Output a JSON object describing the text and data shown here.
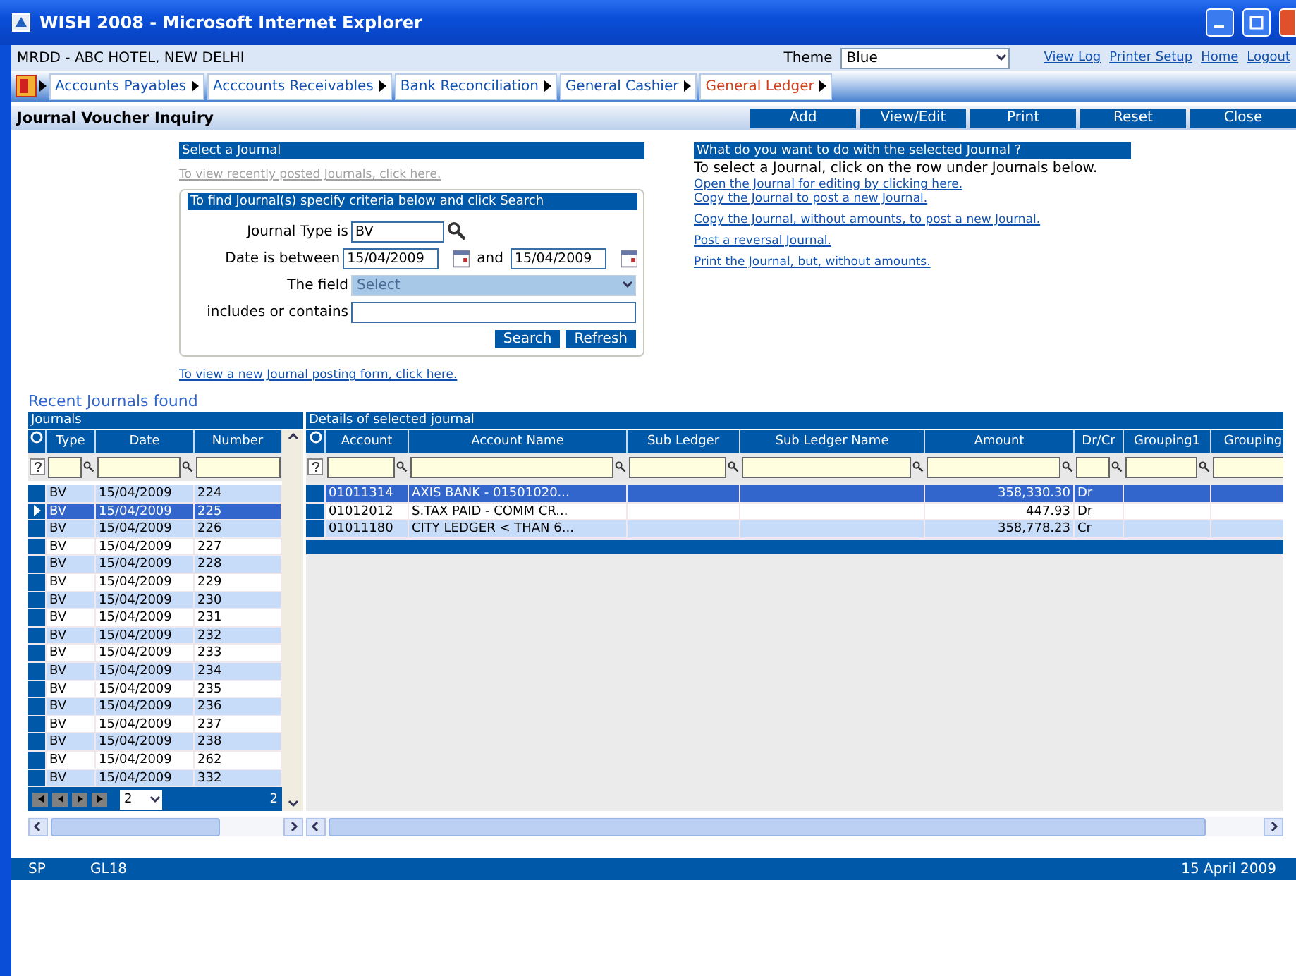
{
  "window": {
    "title": "WISH 2008 - Microsoft Internet Explorer"
  },
  "header": {
    "property": "MRDD - ABC HOTEL, NEW DELHI",
    "theme_label": "Theme",
    "theme_value": "Blue",
    "links": [
      "View Log",
      "Printer Setup",
      "Home",
      "Logout"
    ]
  },
  "modules": [
    {
      "label": "Accounts Payables",
      "selected": false
    },
    {
      "label": "Acccounts Receivables",
      "selected": false
    },
    {
      "label": "Bank Reconciliation",
      "selected": false
    },
    {
      "label": "General Cashier",
      "selected": false
    },
    {
      "label": "General Ledger",
      "selected": true
    }
  ],
  "page": {
    "title": "Journal Voucher Inquiry",
    "buttons": [
      "Add",
      "View/Edit",
      "Print",
      "Reset",
      "Close"
    ]
  },
  "select_panel": {
    "heading": "Select a Journal",
    "recent_link": "To view recently posted Journals, click here.",
    "criteria_heading": "To find Journal(s) specify criteria below and click Search",
    "fields": [
      {
        "kind": "lookup",
        "label": "Journal Type is",
        "value": "BV"
      },
      {
        "kind": "date_range",
        "label": "Date is between",
        "from": "15/04/2009",
        "joiner": "and",
        "to": "15/04/2009"
      },
      {
        "kind": "select",
        "label": "The field",
        "placeholder": "Select",
        "disabled": true
      },
      {
        "kind": "text",
        "label": "includes or contains"
      }
    ],
    "buttons": [
      "Search",
      "Refresh"
    ],
    "new_link": "To view a new Journal posting form, click here."
  },
  "actions_panel": {
    "heading": "What do you want to do with the selected Journal ?",
    "instruction": "To select a Journal, click on the row under Journals below.",
    "links": [
      "Open the Journal for editing by clicking here.",
      "Copy the Journal to post a new Journal.",
      "Copy the Journal, without amounts, to post a new Journal.",
      "Post a reversal Journal.",
      "Print the Journal, but, without amounts."
    ]
  },
  "recent_heading": "Recent Journals found",
  "journals": {
    "title": "Journals",
    "columns": [
      "Type",
      "Date",
      "Number"
    ],
    "rows": [
      {
        "type": "BV",
        "date": "15/04/2009",
        "number": "224",
        "selected": false
      },
      {
        "type": "BV",
        "date": "15/04/2009",
        "number": "225",
        "selected": true
      },
      {
        "type": "BV",
        "date": "15/04/2009",
        "number": "226",
        "selected": false
      },
      {
        "type": "BV",
        "date": "15/04/2009",
        "number": "227",
        "selected": false
      },
      {
        "type": "BV",
        "date": "15/04/2009",
        "number": "228",
        "selected": false
      },
      {
        "type": "BV",
        "date": "15/04/2009",
        "number": "229",
        "selected": false
      },
      {
        "type": "BV",
        "date": "15/04/2009",
        "number": "230",
        "selected": false
      },
      {
        "type": "BV",
        "date": "15/04/2009",
        "number": "231",
        "selected": false
      },
      {
        "type": "BV",
        "date": "15/04/2009",
        "number": "232",
        "selected": false
      },
      {
        "type": "BV",
        "date": "15/04/2009",
        "number": "233",
        "selected": false
      },
      {
        "type": "BV",
        "date": "15/04/2009",
        "number": "234",
        "selected": false
      },
      {
        "type": "BV",
        "date": "15/04/2009",
        "number": "235",
        "selected": false
      },
      {
        "type": "BV",
        "date": "15/04/2009",
        "number": "236",
        "selected": false
      },
      {
        "type": "BV",
        "date": "15/04/2009",
        "number": "237",
        "selected": false
      },
      {
        "type": "BV",
        "date": "15/04/2009",
        "number": "238",
        "selected": false
      },
      {
        "type": "BV",
        "date": "15/04/2009",
        "number": "262",
        "selected": false
      },
      {
        "type": "BV",
        "date": "15/04/2009",
        "number": "332",
        "selected": false
      }
    ],
    "pager": {
      "page": "2",
      "count": "2"
    }
  },
  "details": {
    "title": "Details of selected journal",
    "columns": [
      "Account",
      "Account Name",
      "Sub Ledger",
      "Sub Ledger Name",
      "Amount",
      "Dr/Cr",
      "Grouping1",
      "Grouping"
    ],
    "rows": [
      {
        "account": "01011314",
        "name": "AXIS BANK - 01501020...",
        "amount": "358,330.30",
        "drcr": "Dr",
        "selected": true
      },
      {
        "account": "01012012",
        "name": "S.TAX PAID - COMM CR...",
        "amount": "447.93",
        "drcr": "Dr",
        "selected": false
      },
      {
        "account": "01011180",
        "name": "CITY LEDGER < THAN 6...",
        "amount": "358,778.23",
        "drcr": "Cr",
        "selected": false
      }
    ]
  },
  "status_bar": {
    "user": "SP",
    "code": "GL18",
    "date": "15 April 2009"
  }
}
